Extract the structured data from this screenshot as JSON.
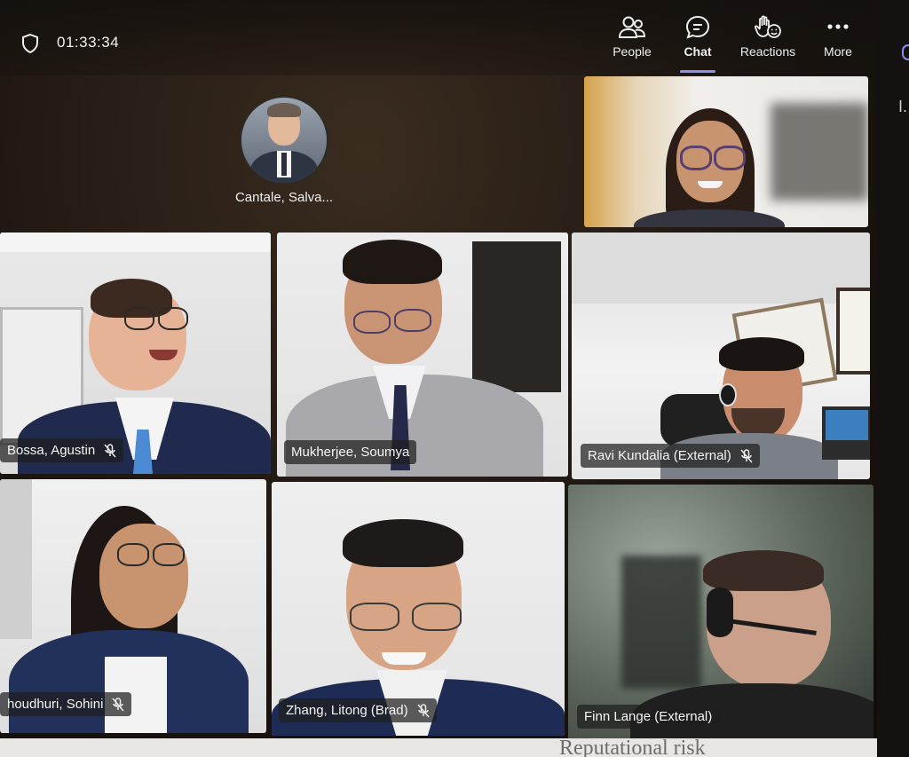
{
  "meeting": {
    "timer": "01:33:34"
  },
  "toolbar": {
    "people_label": "People",
    "chat_label": "Chat",
    "reactions_label": "Reactions",
    "more_label": "More",
    "active_tab": "Chat",
    "accent_color": "#8b8ff0"
  },
  "side_panel": {
    "partial_text": "I."
  },
  "avatar_participant": {
    "name": "Cantale, Salva..."
  },
  "participants": [
    {
      "name": "Bossa, Agustin",
      "muted": true
    },
    {
      "name": "Mukherjee, Soumya",
      "muted": false,
      "active_speaker": true
    },
    {
      "name": "Ravi Kundalia (External)",
      "muted": true
    },
    {
      "name": "houdhuri, Sohini",
      "muted": true
    },
    {
      "name": "Zhang, Litong (Brad)",
      "muted": true
    },
    {
      "name": "Finn Lange (External)",
      "muted": false
    }
  ],
  "background_text": "Reputational risk",
  "icons": {
    "shield": "shield-icon",
    "people": "people-icon",
    "chat": "chat-icon",
    "reactions": "raise-hand-icon",
    "more": "more-icon",
    "mic_off": "mic-off-icon"
  }
}
